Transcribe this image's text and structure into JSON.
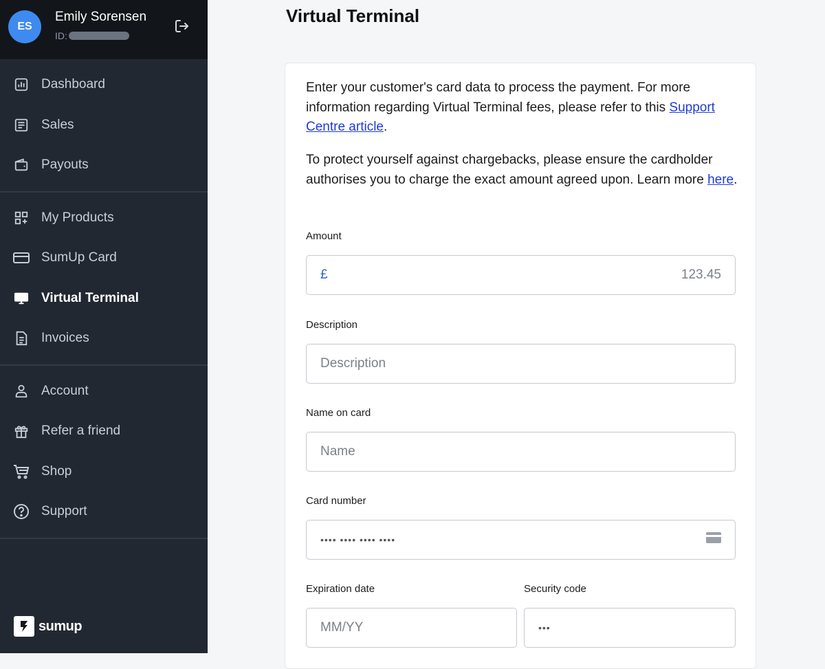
{
  "user": {
    "initials": "ES",
    "name": "Emily Sorensen",
    "id_label": "ID:"
  },
  "nav": {
    "groups": [
      [
        {
          "label": "Dashboard",
          "icon": "chart-icon"
        },
        {
          "label": "Sales",
          "icon": "receipt-icon"
        },
        {
          "label": "Payouts",
          "icon": "wallet-icon"
        }
      ],
      [
        {
          "label": "My Products",
          "icon": "grid-plus-icon"
        },
        {
          "label": "SumUp Card",
          "icon": "card-icon"
        },
        {
          "label": "Virtual Terminal",
          "icon": "monitor-icon",
          "active": true
        },
        {
          "label": "Invoices",
          "icon": "document-icon"
        }
      ],
      [
        {
          "label": "Account",
          "icon": "person-icon"
        },
        {
          "label": "Refer a friend",
          "icon": "gift-icon"
        },
        {
          "label": "Shop",
          "icon": "cart-icon"
        },
        {
          "label": "Support",
          "icon": "help-icon"
        }
      ]
    ]
  },
  "brand": {
    "wordmark": "sumup",
    "glyph": "S"
  },
  "page": {
    "title": "Virtual Terminal"
  },
  "intro": {
    "p1_text": "Enter your customer's card data to process the payment. For more information regarding Virtual Terminal fees, please refer to this ",
    "p1_link": "Support Centre article",
    "p1_end": ".",
    "p2_text": "To protect yourself against chargebacks, please ensure the cardholder authorises you to charge the exact amount agreed upon. Learn more ",
    "p2_link": "here",
    "p2_end": "."
  },
  "form": {
    "amount_label": "Amount",
    "currency": "£",
    "amount_placeholder": "123.45",
    "description_label": "Description",
    "description_placeholder": "Description",
    "name_label": "Name on card",
    "name_placeholder": "Name",
    "card_label": "Card number",
    "card_placeholder": "•••• •••• •••• ••••",
    "expiry_label": "Expiration date",
    "expiry_placeholder": "MM/YY",
    "security_label": "Security code",
    "security_placeholder": "•••"
  },
  "colors": {
    "sidebar_bg": "#222831",
    "header_bg": "#12161b",
    "avatar": "#3f8af0",
    "link": "#1f3bd6",
    "currency": "#3063e0"
  }
}
